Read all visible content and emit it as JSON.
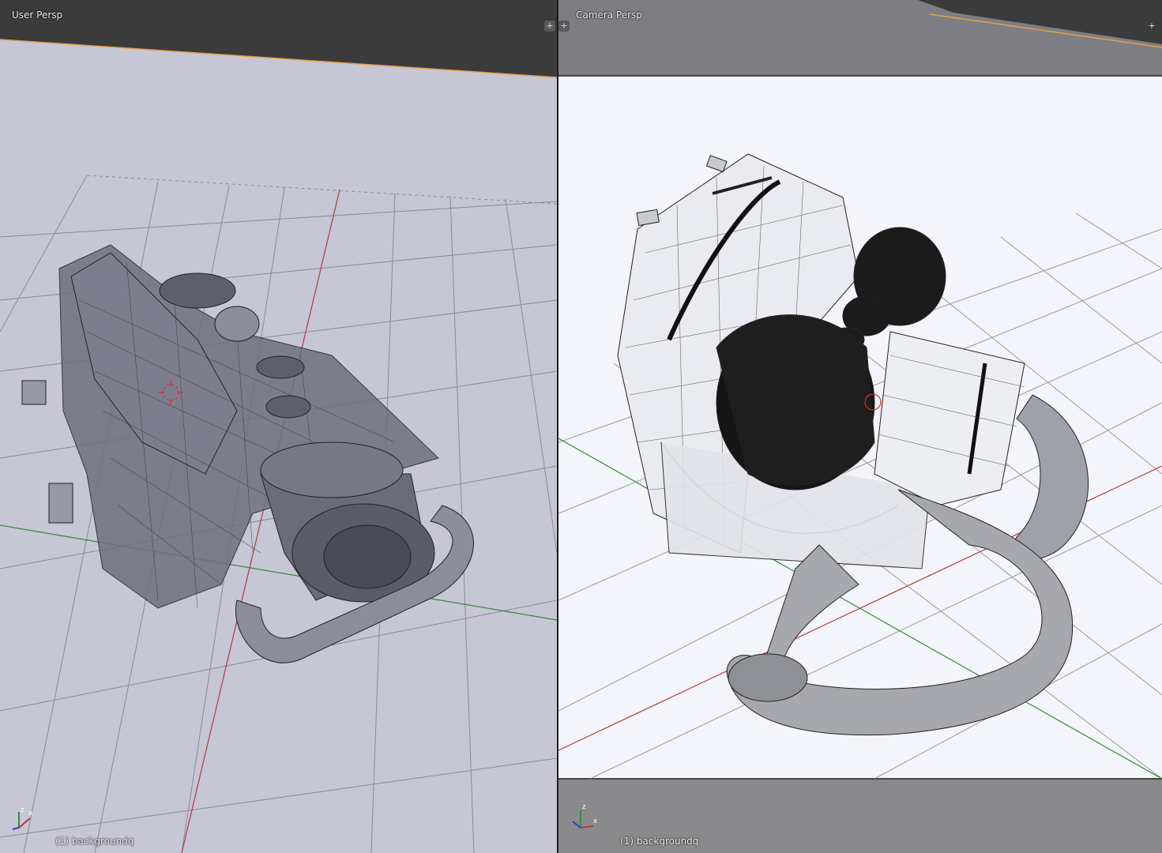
{
  "viewports": {
    "left": {
      "label": "User Persp",
      "footer": "(1) backgroundq",
      "corner_icon": "+"
    },
    "right": {
      "label": "Camera Persp",
      "footer": "(1) backgroundq",
      "corner_icon": "+"
    }
  },
  "axis_gizmo": {
    "x": "x",
    "z": "z"
  },
  "colors": {
    "left_bg": "#c6c6d4",
    "right_bg": "#8a8a8c",
    "camera_frame": "#f4f5fa",
    "header_band": "#3b3b3b",
    "x_axis": "#b23a3a",
    "y_axis": "#3a8a3a",
    "selection_edge": "#e0a050"
  }
}
